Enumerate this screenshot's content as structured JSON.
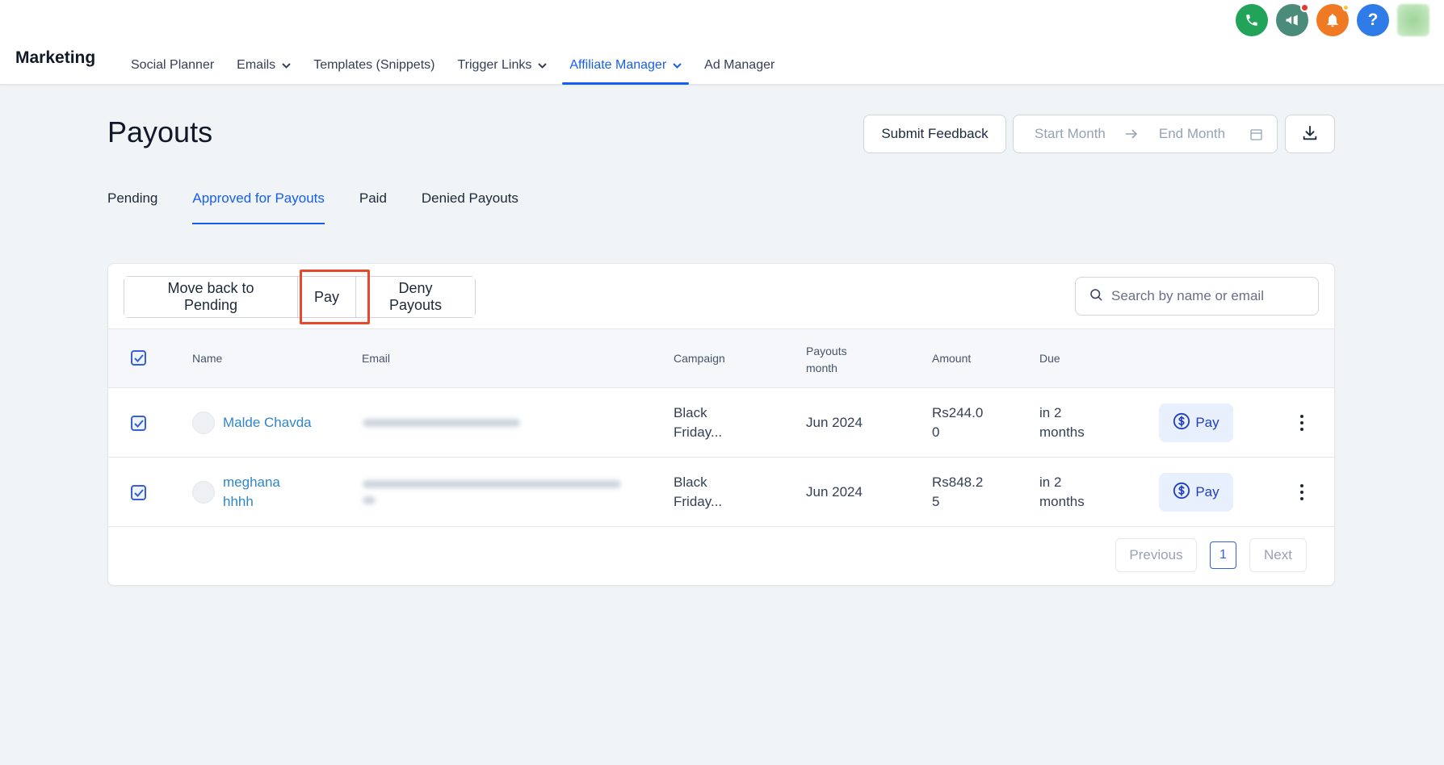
{
  "topbar": {
    "brand": "Marketing",
    "nav": [
      {
        "label": "Social Planner",
        "dropdown": false,
        "active": false
      },
      {
        "label": "Emails",
        "dropdown": true,
        "active": false
      },
      {
        "label": "Templates (Snippets)",
        "dropdown": false,
        "active": false
      },
      {
        "label": "Trigger Links",
        "dropdown": true,
        "active": false
      },
      {
        "label": "Affiliate Manager",
        "dropdown": true,
        "active": true
      },
      {
        "label": "Ad Manager",
        "dropdown": false,
        "active": false
      }
    ],
    "icons": [
      "phone-icon",
      "megaphone-icon",
      "bell-icon",
      "help-icon",
      "user-avatar"
    ],
    "help_glyph": "?"
  },
  "page": {
    "title": "Payouts",
    "feedback_label": "Submit Feedback",
    "start_month_placeholder": "Start Month",
    "end_month_placeholder": "End Month"
  },
  "tabs": [
    {
      "label": "Pending",
      "active": false
    },
    {
      "label": "Approved for Payouts",
      "active": true
    },
    {
      "label": "Paid",
      "active": false
    },
    {
      "label": "Denied Payouts",
      "active": false
    }
  ],
  "bulk_actions": {
    "move_back": "Move back to Pending",
    "pay": "Pay",
    "deny": "Deny Payouts"
  },
  "search": {
    "placeholder": "Search by name or email"
  },
  "table": {
    "headers": {
      "name": "Name",
      "email": "Email",
      "campaign": "Campaign",
      "payouts_month_line1": "Payouts",
      "payouts_month_line2": "month",
      "amount": "Amount",
      "due": "Due"
    },
    "rows": [
      {
        "checked": true,
        "name_line1": "Malde Chavda",
        "name_line2": "",
        "campaign_line1": "Black",
        "campaign_line2": "Friday...",
        "payouts_month": "Jun 2024",
        "amount_line1": "Rs244.0",
        "amount_line2": "0",
        "due_line1": "in 2",
        "due_line2": "months",
        "pay_label": "Pay"
      },
      {
        "checked": true,
        "name_line1": "meghana",
        "name_line2": "hhhh",
        "campaign_line1": "Black",
        "campaign_line2": "Friday...",
        "payouts_month": "Jun 2024",
        "amount_line1": "Rs848.2",
        "amount_line2": "5",
        "due_line1": "in 2",
        "due_line2": "months",
        "pay_label": "Pay"
      }
    ]
  },
  "pagination": {
    "previous": "Previous",
    "current_page": "1",
    "next": "Next"
  },
  "colors": {
    "accent": "#155eef",
    "highlight": "#e8492c",
    "link": "#2f86c8"
  }
}
